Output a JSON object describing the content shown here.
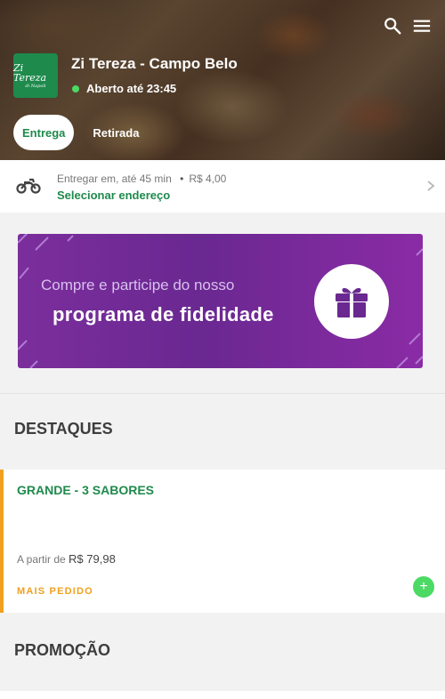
{
  "store": {
    "logo_text": "Zi Tereza",
    "logo_subtext": "di Napoli",
    "name": "Zi Tereza - Campo Belo",
    "status": "Aberto até 23:45",
    "status_color": "#4cd964"
  },
  "header_icons": [
    "search-icon",
    "menu-icon"
  ],
  "mode_tabs": [
    {
      "label": "Entrega",
      "active": true
    },
    {
      "label": "Retirada",
      "active": false
    }
  ],
  "delivery": {
    "prefix": "Entregar em,",
    "time": "até 45 min",
    "separator": "•",
    "fee": "R$ 4,00",
    "action": "Selecionar endereço"
  },
  "banner": {
    "line1": "Compre e participe do nosso",
    "line2": "programa de fidelidade"
  },
  "sections": [
    {
      "title": "DESTAQUES",
      "items": [
        {
          "name": "GRANDE - 3 SABORES",
          "price_prefix": "A partir de",
          "price": "R$ 79,98",
          "badge": "MAIS PEDIDO",
          "add_label": "+"
        }
      ]
    },
    {
      "title": "PROMOÇÃO"
    }
  ],
  "colors": {
    "brand_green": "#1e8a4c",
    "accent_orange": "#f0a020",
    "banner_purple": "#6a2891"
  }
}
